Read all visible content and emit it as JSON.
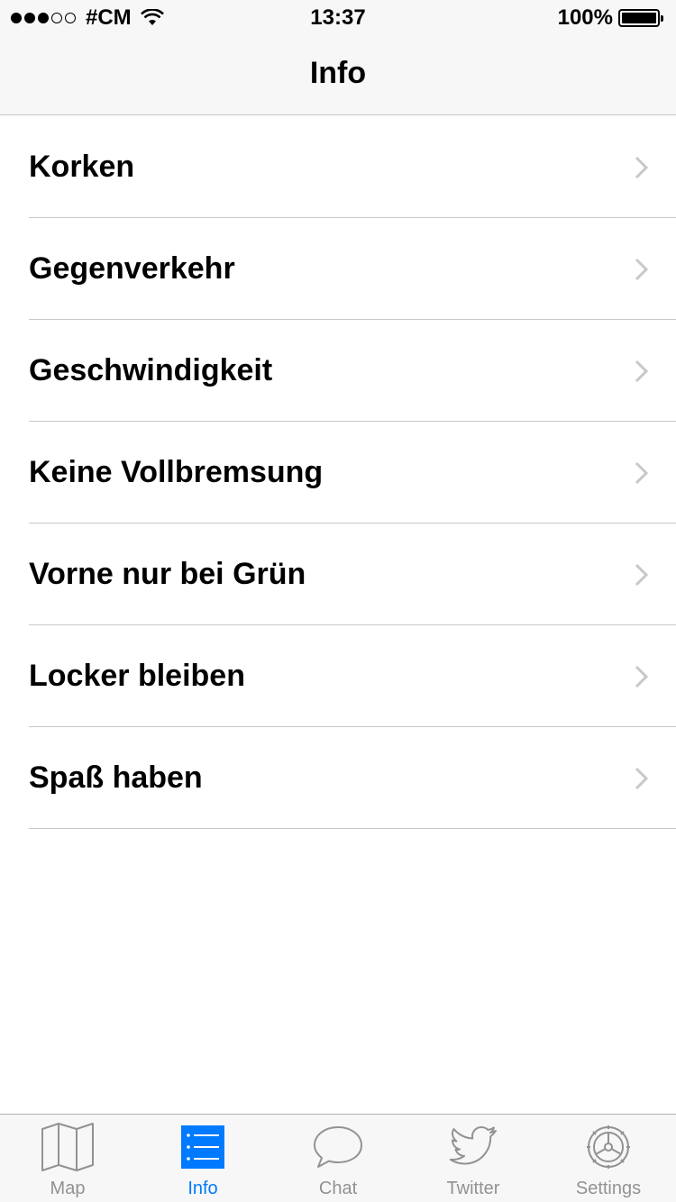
{
  "status_bar": {
    "carrier": "#CM",
    "time": "13:37",
    "battery": "100%"
  },
  "nav": {
    "title": "Info"
  },
  "list": {
    "items": [
      {
        "label": "Korken"
      },
      {
        "label": "Gegenverkehr"
      },
      {
        "label": "Geschwindigkeit"
      },
      {
        "label": "Keine Vollbremsung"
      },
      {
        "label": "Vorne nur bei Grün"
      },
      {
        "label": "Locker bleiben"
      },
      {
        "label": "Spaß haben"
      }
    ]
  },
  "tab_bar": {
    "tabs": [
      {
        "label": "Map",
        "icon": "map-icon"
      },
      {
        "label": "Info",
        "icon": "list-icon",
        "active": true
      },
      {
        "label": "Chat",
        "icon": "chat-bubble-icon"
      },
      {
        "label": "Twitter",
        "icon": "twitter-bird-icon"
      },
      {
        "label": "Settings",
        "icon": "gear-icon"
      }
    ]
  },
  "colors": {
    "accent": "#007aff",
    "inactive": "#929292",
    "separator": "#c8c7cc",
    "bar_background": "#f7f7f7"
  }
}
